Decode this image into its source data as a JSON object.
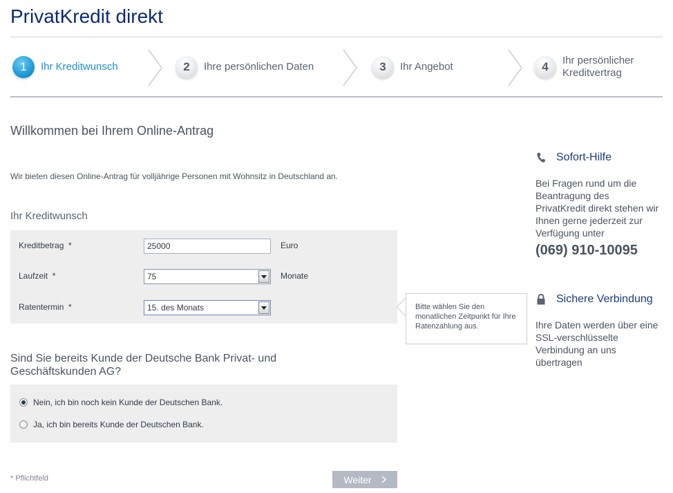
{
  "header": {
    "brand": "PrivatKredit direkt"
  },
  "steps": [
    {
      "number": "1",
      "label": "Ihr Kreditwunsch",
      "active": true
    },
    {
      "number": "2",
      "label": "Ihre persönlichen Daten",
      "active": false
    },
    {
      "number": "3",
      "label": "Ihr Angebot",
      "active": false
    },
    {
      "number": "4",
      "label_line1": "Ihr persönlicher",
      "label_line2": "Kreditvertrag",
      "active": false
    }
  ],
  "main": {
    "title": "Willkommen bei Ihrem Online-Antrag",
    "intro": "Wir bieten diesen Online-Antrag für volljährige Personen mit Wohnsitz in Deutschland an.",
    "section_title": "Ihr Kreditwunsch",
    "fields": {
      "amount": {
        "label": "Kreditbetrag",
        "required": "*",
        "value": "25000",
        "unit": "Euro"
      },
      "term": {
        "label": "Laufzeit",
        "required": "*",
        "value": "75",
        "unit": "Monate"
      },
      "due_date": {
        "label": "Ratentermin",
        "required": "*",
        "value": "15. des Monats"
      }
    },
    "tooltip": "Bitte wählen Sie den monatlichen Zeitpunkt für Ihre Ratenzahlung aus.",
    "customer_question": "Sind Sie bereits Kunde der Deutsche Bank Privat- und Geschäftskunden AG?",
    "radios": [
      {
        "label": "Nein, ich bin noch kein Kunde der Deutschen Bank.",
        "checked": true
      },
      {
        "label": "Ja, ich bin bereits Kunde der Deutschen Bank.",
        "checked": false
      }
    ],
    "required_note": "* Pflichtfeld",
    "next_button": "Weiter"
  },
  "sidebar": {
    "help": {
      "title": "Sofort-Hilfe",
      "icon": "phone-icon",
      "text": "Bei Fragen rund um die Beantragung des PrivatKredit direkt stehen wir Ihnen gerne jederzeit zur Verfügung unter",
      "phone": "(069) 910-10095"
    },
    "secure": {
      "title": "Sichere Verbindung",
      "icon": "lock-icon",
      "text": "Ihre Daten werden über eine SSL-verschlüsselte Verbindung an uns übertragen"
    }
  },
  "colors": {
    "brand": "#0a2a78",
    "active_step": "#1a8fcf",
    "panel": "#eeeeee",
    "button": "#b3bac3"
  }
}
